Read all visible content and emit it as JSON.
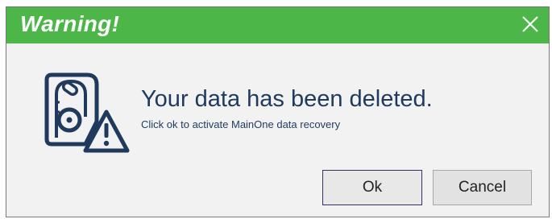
{
  "dialog": {
    "title": "Warning!",
    "close_icon": "close-icon",
    "icon": "hard-drive-warning-icon",
    "message": "Your data has been deleted.",
    "detail": "Click ok to activate MainOne data recovery",
    "buttons": {
      "ok_label": "Ok",
      "cancel_label": "Cancel"
    }
  },
  "colors": {
    "titlebar": "#4cb748",
    "title_text": "#ffffff",
    "body_background": "#f2f2f2",
    "message_text": "#1f3a5c",
    "icon": "#1f3a5c",
    "ok_border": "#3d2d63"
  }
}
